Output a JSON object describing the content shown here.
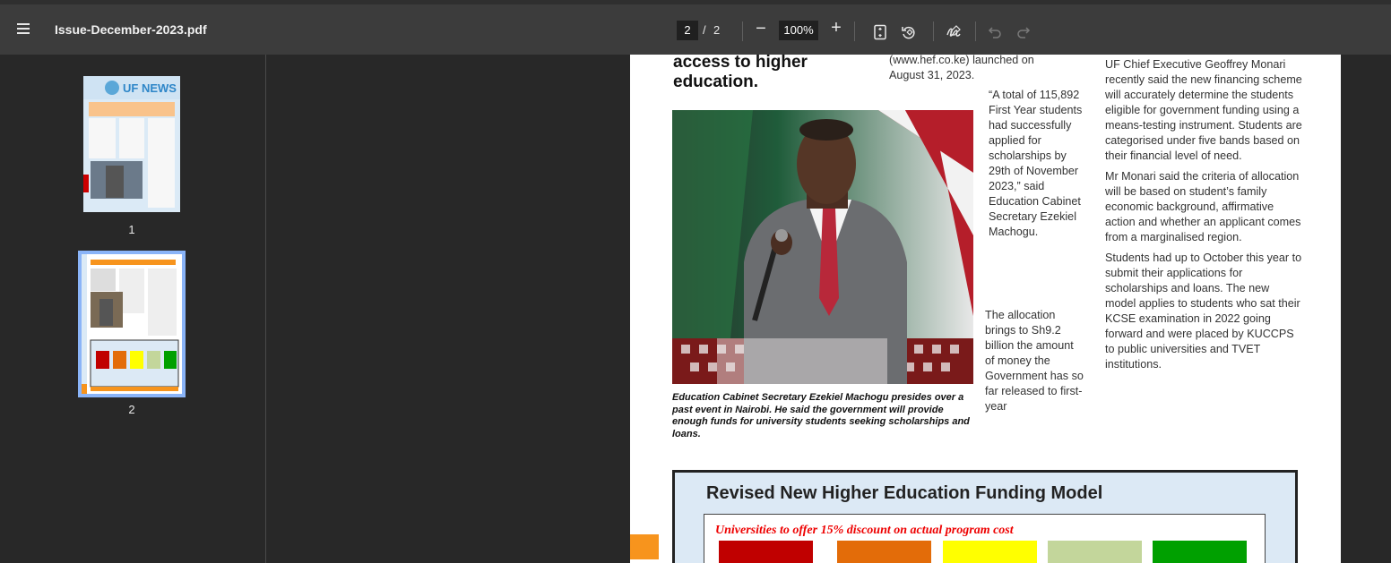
{
  "toolbar": {
    "title": "Issue-December-2023.pdf",
    "page_current": "2",
    "page_sep": "/",
    "page_total": "2",
    "zoom_value": "100%",
    "zoom_minus": "−",
    "zoom_plus": "+"
  },
  "sidebar": {
    "thumbnails": [
      {
        "label": "1",
        "masthead": "UF NEWS"
      },
      {
        "label": "2"
      }
    ]
  },
  "article": {
    "headline": "access to higher education.",
    "col2_top": "(www.hef.co.ke) launched on August 31, 2023.",
    "quote": "“A total of 115,892 First Year students had successfully applied for scholarships by 29th of November 2023,” said Education Cabinet Secretary Ezekiel Machogu.",
    "allocation": "The allocation brings to Sh9.2 billion the amount of money the Government has so far released to first-year",
    "col3_p1": "UF Chief Executive Geoffrey Monari recently said the new financing scheme will accurately determine the students eligible for government funding using a means-testing instrument. Students are categorised under five bands based on their financial level of need.",
    "col3_p2": "Mr Monari said the criteria of allocation will be based on student’s family economic background, affirmative action and whether an applicant comes from a marginalised region.",
    "col3_p3": "Students had up to October this year to submit their applications for scholarships and loans. The new model applies to students who sat their KCSE examination in 2022 going forward and were placed by KUCCPS to public universities and TVET institutions.",
    "caption": "Education Cabinet Secretary Ezekiel Machogu presides over a past event in Nairobi. He said the government will provide enough funds for university students seeking scholarships and loans."
  },
  "funding_box": {
    "title": "Revised New Higher Education Funding Model",
    "subtitle": "Universities to offer 15% discount on actual program cost",
    "band_colors": [
      "#c00000",
      "#e36c09",
      "#ffff00",
      "#c3d69b",
      "#00a000"
    ]
  }
}
